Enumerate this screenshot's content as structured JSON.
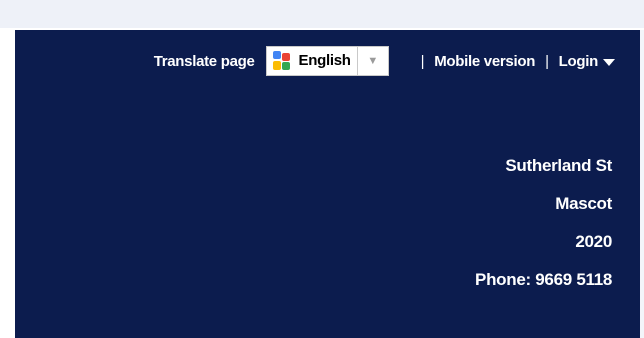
{
  "header": {
    "translate_label": "Translate page",
    "language_selected": "English",
    "separator": "|",
    "mobile_link": "Mobile version",
    "login_label": "Login"
  },
  "address": {
    "street": "Sutherland St",
    "suburb": "Mascot",
    "postcode": "2020",
    "phone": "Phone: 9669 5118"
  },
  "colors": {
    "header_background": "#0c1c4e",
    "top_strip": "#eef1f8",
    "text": "#ffffff"
  }
}
